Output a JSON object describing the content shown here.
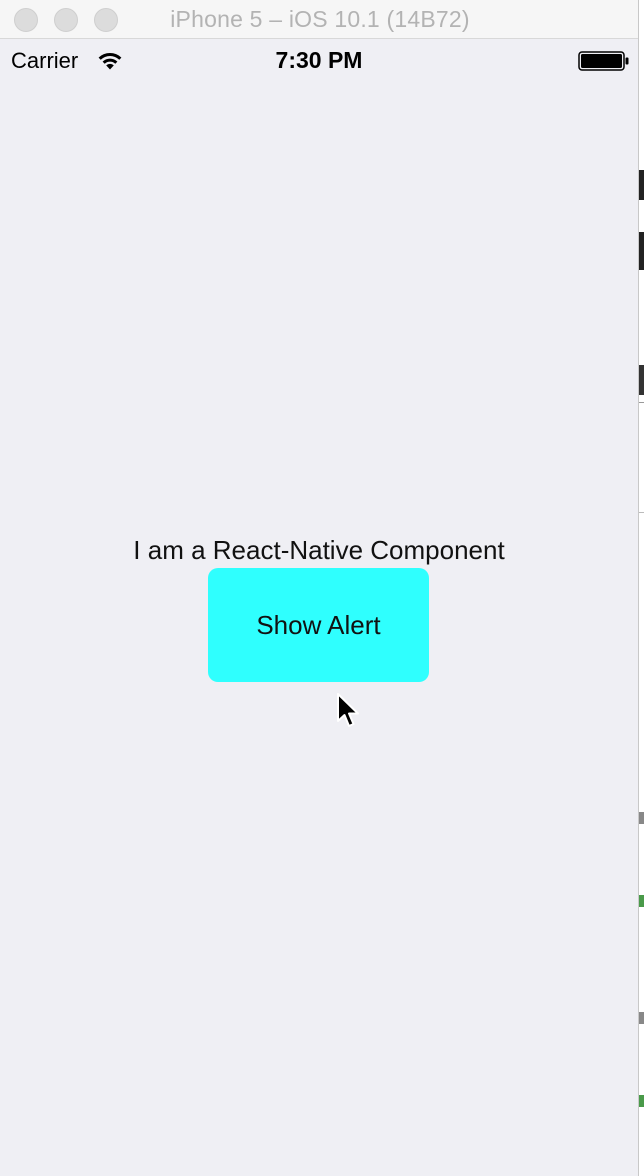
{
  "window": {
    "title": "iPhone 5 – iOS 10.1 (14B72)"
  },
  "status_bar": {
    "carrier": "Carrier",
    "time": "7:30 PM",
    "icons": [
      "wifi-icon",
      "battery-icon"
    ]
  },
  "content": {
    "text": "I am a React-Native Component",
    "button_label": "Show Alert"
  },
  "colors": {
    "screen_background": "#efeff4",
    "button_background": "#2ffffe",
    "title_text": "#b3b3b3"
  }
}
